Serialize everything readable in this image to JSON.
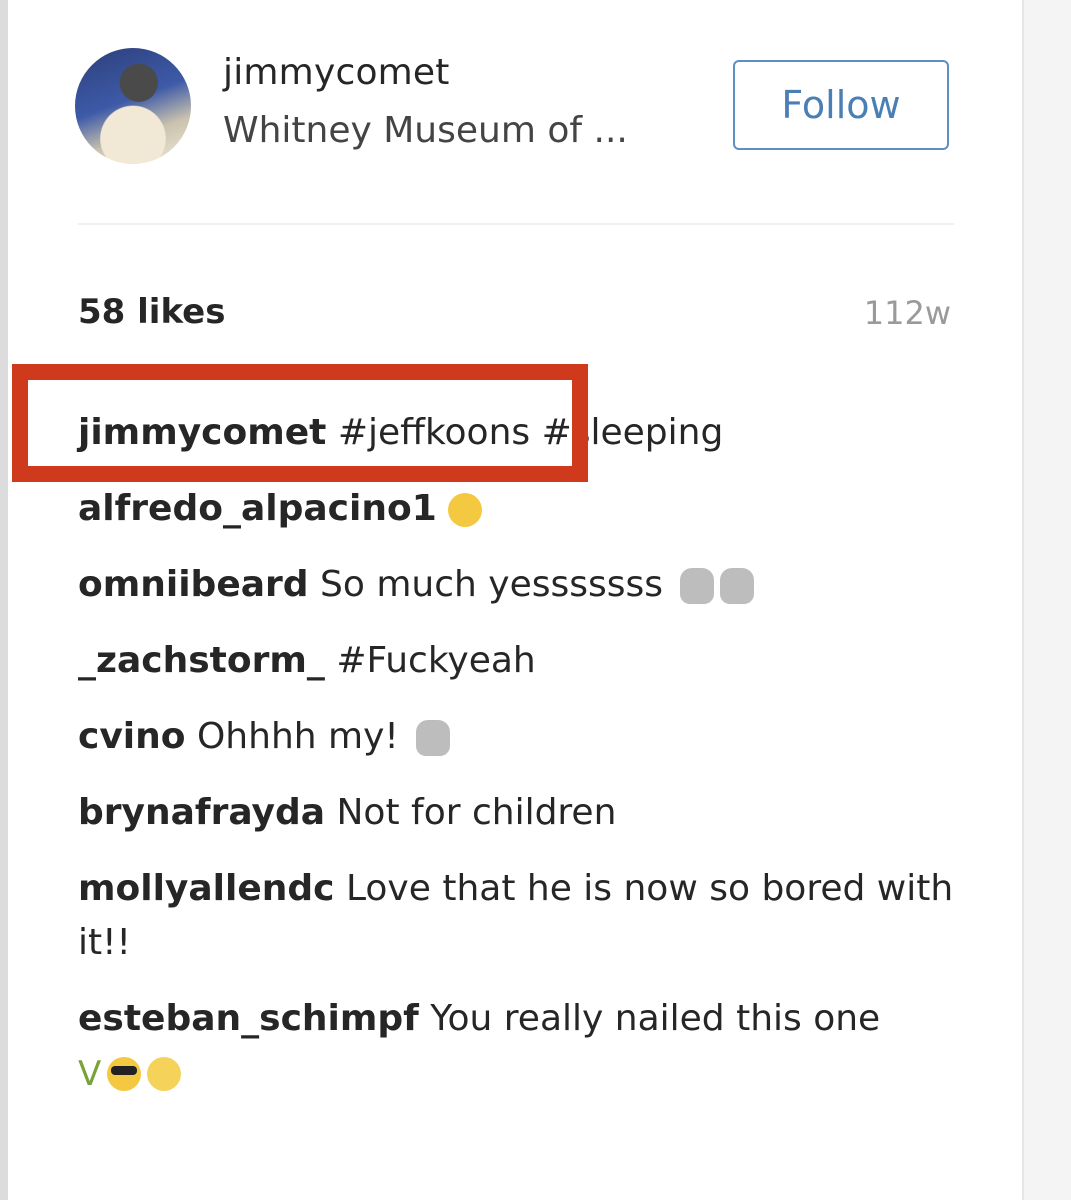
{
  "post": {
    "username": "jimmycomet",
    "location": "Whitney Museum of ...",
    "follow_label": "Follow",
    "likes": "58 likes",
    "time": "112w"
  },
  "comments": [
    {
      "user": "jimmycomet",
      "text": "#jeffkoons #sleeping",
      "emoji": ""
    },
    {
      "user": "alfredo_alpacino1",
      "text": "",
      "emoji": "screaming-face"
    },
    {
      "user": "omniibeard",
      "text": "So much yesssssss",
      "emoji": "raised-hands"
    },
    {
      "user": "_zachstorm_",
      "text": "#Fuckyeah",
      "emoji": ""
    },
    {
      "user": "cvino",
      "text": "Ohhhh my!",
      "emoji": "ok-hand"
    },
    {
      "user": "brynafrayda",
      "text": "Not for children",
      "emoji": ""
    },
    {
      "user": "mollyallendc",
      "text": "Love that he is now so bored with it!!",
      "emoji": ""
    },
    {
      "user": "esteban_schimpf",
      "text": "You really nailed this one",
      "emoji": "victory-cool-smile"
    }
  ],
  "colors": {
    "highlight": "#d03a1c",
    "follow_border": "#5c8fc2",
    "hashtag": "#3f6d99"
  }
}
